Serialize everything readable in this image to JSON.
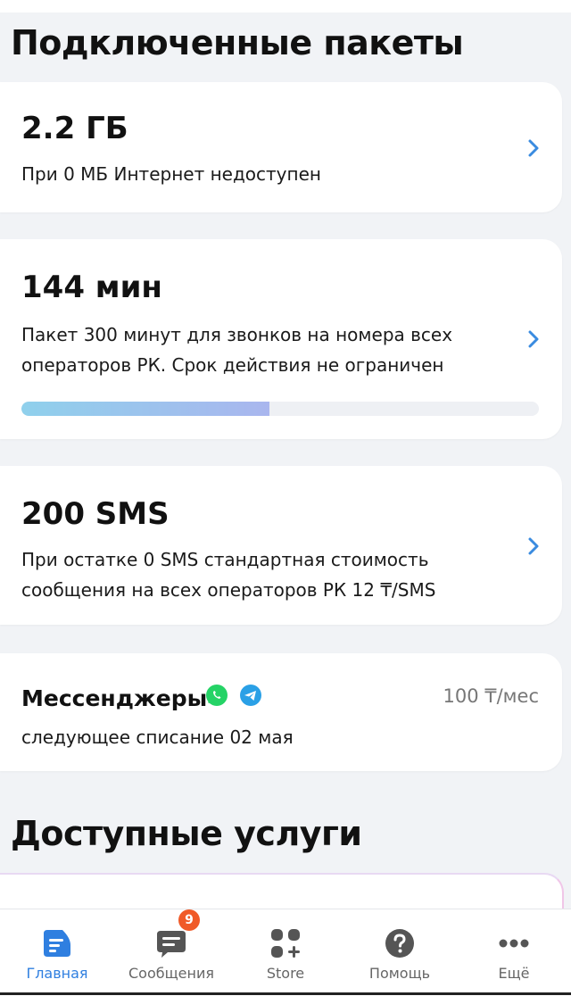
{
  "sections": {
    "connected_title": "Подключенные пакеты",
    "available_title": "Доступные услуги"
  },
  "packages": [
    {
      "amount": "2.2 ГБ",
      "description": "При 0 МБ Интернет недоступен"
    },
    {
      "amount": "144 мин",
      "description": "Пакет 300 минут для звонков на номера всех операторов РК. Срок действия не ограничен",
      "progress_percent": 48
    },
    {
      "amount": "200 SMS",
      "description": "При остатке 0 SMS стандартная стоимость сообщения на всех операторов РК 12 ₸/SMS"
    }
  ],
  "messengers": {
    "title": "Мессенджеры",
    "price": "100 ₸/мес",
    "next_charge": "следующее списание 02 мая",
    "icons": [
      "whatsapp-icon",
      "telegram-icon"
    ],
    "whatsapp_color": "#25d366",
    "telegram_color": "#2aa0e6"
  },
  "tabbar": {
    "tabs": [
      {
        "label": "Главная",
        "icon": "home-card-icon",
        "active": true
      },
      {
        "label": "Сообщения",
        "icon": "chat-icon",
        "badge": "9"
      },
      {
        "label": "Store",
        "icon": "store-grid-icon"
      },
      {
        "label": "Помощь",
        "icon": "help-icon"
      },
      {
        "label": "Ещё",
        "icon": "more-icon"
      }
    ],
    "active_color": "#2f7fe0",
    "badge_color": "#f05a28"
  }
}
